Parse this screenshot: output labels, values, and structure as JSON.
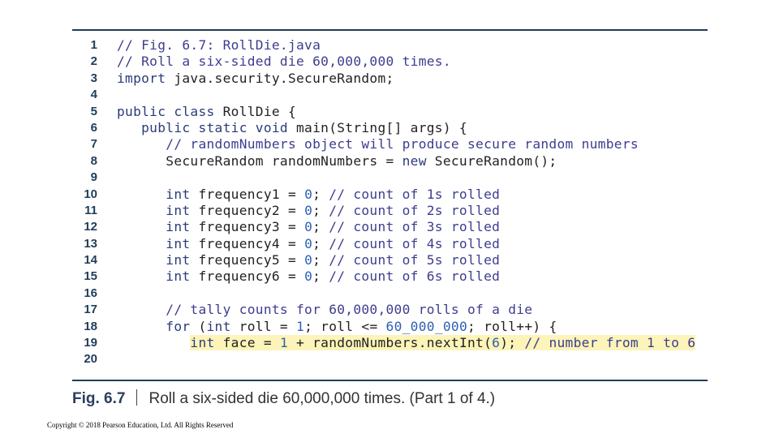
{
  "code_lines": [
    {
      "n": "1",
      "segs": [
        {
          "t": "// Fig. 6.7: RollDie.java",
          "c": "cm"
        }
      ]
    },
    {
      "n": "2",
      "segs": [
        {
          "t": "// Roll a six-sided die 60,000,000 times.",
          "c": "cm"
        }
      ]
    },
    {
      "n": "3",
      "segs": [
        {
          "t": "import",
          "c": "kw"
        },
        {
          "t": " java.security.SecureRandom;",
          "c": ""
        }
      ]
    },
    {
      "n": "4",
      "segs": []
    },
    {
      "n": "5",
      "segs": [
        {
          "t": "public class",
          "c": "kw"
        },
        {
          "t": " RollDie {",
          "c": ""
        }
      ]
    },
    {
      "n": "6",
      "segs": [
        {
          "t": "   ",
          "c": ""
        },
        {
          "t": "public static void",
          "c": "kw"
        },
        {
          "t": " main(String[] args) {",
          "c": ""
        }
      ]
    },
    {
      "n": "7",
      "segs": [
        {
          "t": "      ",
          "c": ""
        },
        {
          "t": "// randomNumbers object will produce secure random numbers",
          "c": "cm"
        }
      ]
    },
    {
      "n": "8",
      "segs": [
        {
          "t": "      SecureRandom randomNumbers = ",
          "c": ""
        },
        {
          "t": "new",
          "c": "kw"
        },
        {
          "t": " SecureRandom();",
          "c": ""
        }
      ]
    },
    {
      "n": "9",
      "segs": []
    },
    {
      "n": "10",
      "segs": [
        {
          "t": "      ",
          "c": ""
        },
        {
          "t": "int",
          "c": "kw"
        },
        {
          "t": " frequency1 = ",
          "c": ""
        },
        {
          "t": "0",
          "c": "num"
        },
        {
          "t": "; ",
          "c": ""
        },
        {
          "t": "// count of 1s rolled",
          "c": "cm"
        }
      ]
    },
    {
      "n": "11",
      "segs": [
        {
          "t": "      ",
          "c": ""
        },
        {
          "t": "int",
          "c": "kw"
        },
        {
          "t": " frequency2 = ",
          "c": ""
        },
        {
          "t": "0",
          "c": "num"
        },
        {
          "t": "; ",
          "c": ""
        },
        {
          "t": "// count of 2s rolled",
          "c": "cm"
        }
      ]
    },
    {
      "n": "12",
      "segs": [
        {
          "t": "      ",
          "c": ""
        },
        {
          "t": "int",
          "c": "kw"
        },
        {
          "t": " frequency3 = ",
          "c": ""
        },
        {
          "t": "0",
          "c": "num"
        },
        {
          "t": "; ",
          "c": ""
        },
        {
          "t": "// count of 3s rolled",
          "c": "cm"
        }
      ]
    },
    {
      "n": "13",
      "segs": [
        {
          "t": "      ",
          "c": ""
        },
        {
          "t": "int",
          "c": "kw"
        },
        {
          "t": " frequency4 = ",
          "c": ""
        },
        {
          "t": "0",
          "c": "num"
        },
        {
          "t": "; ",
          "c": ""
        },
        {
          "t": "// count of 4s rolled",
          "c": "cm"
        }
      ]
    },
    {
      "n": "14",
      "segs": [
        {
          "t": "      ",
          "c": ""
        },
        {
          "t": "int",
          "c": "kw"
        },
        {
          "t": " frequency5 = ",
          "c": ""
        },
        {
          "t": "0",
          "c": "num"
        },
        {
          "t": "; ",
          "c": ""
        },
        {
          "t": "// count of 5s rolled",
          "c": "cm"
        }
      ]
    },
    {
      "n": "15",
      "segs": [
        {
          "t": "      ",
          "c": ""
        },
        {
          "t": "int",
          "c": "kw"
        },
        {
          "t": " frequency6 = ",
          "c": ""
        },
        {
          "t": "0",
          "c": "num"
        },
        {
          "t": "; ",
          "c": ""
        },
        {
          "t": "// count of 6s rolled",
          "c": "cm"
        }
      ]
    },
    {
      "n": "16",
      "segs": []
    },
    {
      "n": "17",
      "segs": [
        {
          "t": "      ",
          "c": ""
        },
        {
          "t": "// tally counts for 60,000,000 rolls of a die",
          "c": "cm"
        }
      ]
    },
    {
      "n": "18",
      "segs": [
        {
          "t": "      ",
          "c": ""
        },
        {
          "t": "for",
          "c": "kw"
        },
        {
          "t": " (",
          "c": ""
        },
        {
          "t": "int",
          "c": "kw"
        },
        {
          "t": " roll = ",
          "c": ""
        },
        {
          "t": "1",
          "c": "num"
        },
        {
          "t": "; roll <= ",
          "c": ""
        },
        {
          "t": "60_000_000",
          "c": "num"
        },
        {
          "t": "; roll++) {",
          "c": ""
        }
      ]
    },
    {
      "n": "19",
      "indent": "         ",
      "highlight": true,
      "segs": [
        {
          "t": "int",
          "c": "kw"
        },
        {
          "t": " face = ",
          "c": ""
        },
        {
          "t": "1",
          "c": "num"
        },
        {
          "t": " + randomNumbers.nextInt(",
          "c": ""
        },
        {
          "t": "6",
          "c": "num"
        },
        {
          "t": "); ",
          "c": ""
        },
        {
          "t": "// number from 1 to 6",
          "c": "cm"
        }
      ]
    },
    {
      "n": "20",
      "segs": []
    }
  ],
  "caption": {
    "label": "Fig. 6.7",
    "text": "Roll a six-sided die 60,000,000 times. (Part 1 of 4.)"
  },
  "copyright": "Copyright © 2018 Pearson Education, Ltd. All Rights Reserved",
  "colors": {
    "rule": "#1f3d5a",
    "highlight": "#fcf4b8",
    "comment": "#3d3d8f",
    "keyword": "#2a3c7a",
    "number": "#2d5fb5"
  }
}
